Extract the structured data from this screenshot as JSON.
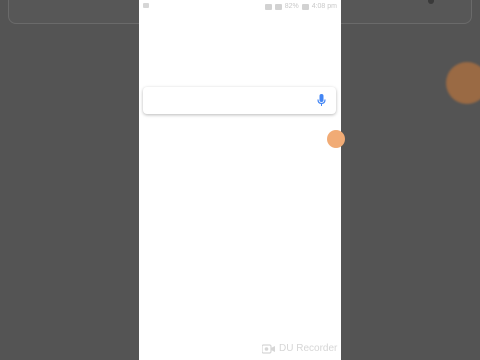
{
  "status_bar": {
    "battery": "82%",
    "time": "4:08 pm"
  },
  "search": {
    "value": "",
    "placeholder": "",
    "mic_icon": "mic-icon"
  },
  "overlay": {
    "floating_handle_color": "#f1ab75"
  },
  "watermark": {
    "label": "DU Recorder",
    "icon": "video-camera-icon"
  },
  "colors": {
    "background": "#545454",
    "screen": "#ffffff",
    "mic_blue": "#4285f4"
  }
}
